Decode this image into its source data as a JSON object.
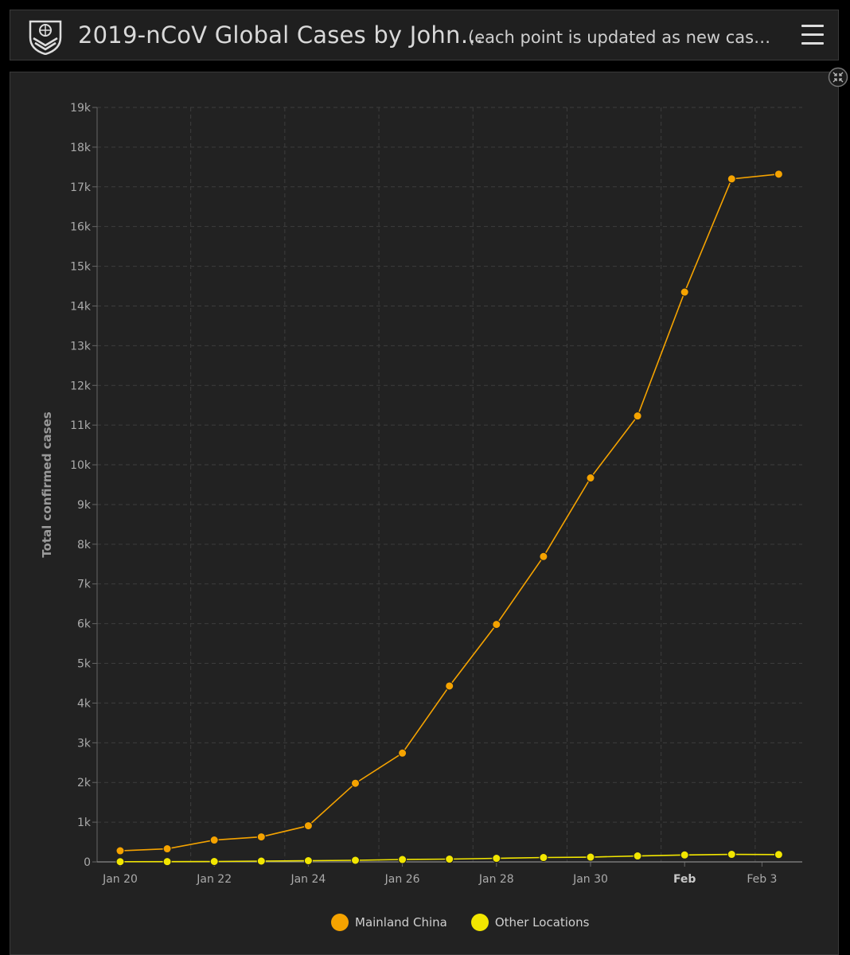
{
  "header": {
    "title": "2019-nCoV Global Cases by John…",
    "subtitle": "(each point is updated as new cas…"
  },
  "icons": {
    "logo": "university-shield-logo",
    "menu": "hamburger-menu-icon",
    "collapse": "collapse-arrows-icon"
  },
  "colors": {
    "mainland_china": "#f5a300",
    "other_locations": "#f2e600",
    "background": "#222222"
  },
  "chart_data": {
    "type": "line",
    "ylabel": "Total confirmed cases",
    "xlabel": "",
    "ylim": [
      0,
      19000
    ],
    "yticks": [
      "0",
      "1k",
      "2k",
      "3k",
      "4k",
      "5k",
      "6k",
      "7k",
      "8k",
      "9k",
      "10k",
      "11k",
      "12k",
      "13k",
      "14k",
      "15k",
      "16k",
      "17k",
      "18k",
      "19k"
    ],
    "xticks": [
      "Jan 20",
      "Jan 22",
      "Jan 24",
      "Jan 26",
      "Jan 28",
      "Jan 30",
      "Feb",
      "Feb 3"
    ],
    "x": [
      "2020-01-20",
      "2020-01-21",
      "2020-01-22",
      "2020-01-23",
      "2020-01-24",
      "2020-01-25",
      "2020-01-26",
      "2020-01-27",
      "2020-01-28",
      "2020-01-29",
      "2020-01-30",
      "2020-01-31",
      "2020-02-01",
      "2020-02-02",
      "2020-02-03"
    ],
    "series": [
      {
        "name": "Mainland China",
        "values": [
          280,
          330,
          550,
          630,
          910,
          1980,
          2740,
          4430,
          5980,
          7690,
          9670,
          11230,
          14350,
          17200,
          17320
        ]
      },
      {
        "name": "Other Locations",
        "values": [
          5,
          7,
          10,
          20,
          30,
          40,
          60,
          70,
          90,
          110,
          120,
          150,
          175,
          190,
          185
        ]
      }
    ],
    "grid": true,
    "legend_position": "bottom-center"
  }
}
